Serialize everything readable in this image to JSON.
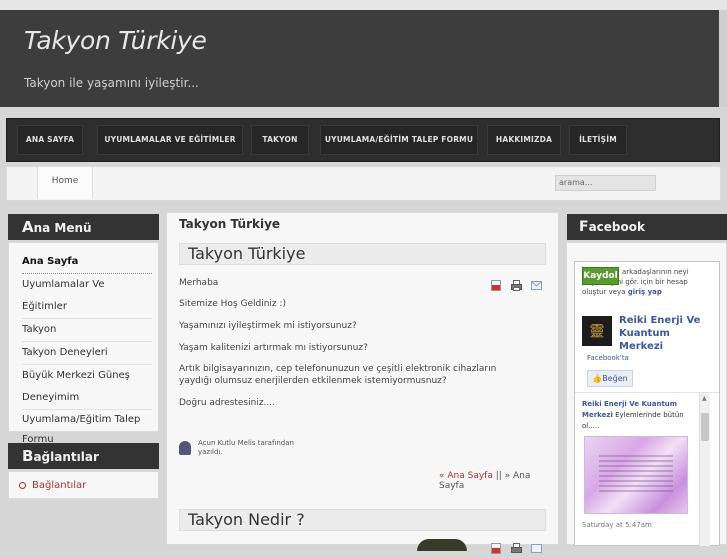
{
  "site": {
    "title": "Takyon Türkiye",
    "slogan": "Takyon ile yaşamını iyileştir..."
  },
  "nav": {
    "items": [
      {
        "label": "ANA SAYFA"
      },
      {
        "label": "UYUMLAMALAR VE EĞİTİMLER"
      },
      {
        "label": "TAKYON"
      },
      {
        "label": "UYUMLAMA/EĞİTİM TALEP FORMU"
      },
      {
        "label": "HAKKIMIZDA"
      },
      {
        "label": "İLETİŞİM"
      }
    ]
  },
  "breadcrumb": {
    "home": "Home"
  },
  "search": {
    "value": "arama..."
  },
  "sidebar": {
    "menu_title_first": "A",
    "menu_title_rest": "na Menü",
    "menu": [
      {
        "label": "Ana Sayfa"
      },
      {
        "label": "Uyumlamalar Ve Eğitimler"
      },
      {
        "label": "Takyon"
      },
      {
        "label": "Takyon Deneyleri"
      },
      {
        "label": "Büyük Merkezi Güneş"
      },
      {
        "label": "Deneyimim"
      },
      {
        "label": "Uyumlama/Eğitim Talep Formu"
      }
    ],
    "links_title_first": "B",
    "links_title_rest": "ağlantılar",
    "links": [
      {
        "label": "Bağlantılar"
      }
    ]
  },
  "main": {
    "page_title": "Takyon Türkiye",
    "article": {
      "title": "Takyon Türkiye",
      "paragraphs": [
        "Merhaba",
        "Sitemize Hoş Geldiniz :)",
        "Yaşamınızı iyileştirmek mi istiyorsunuz?",
        "Yaşam kalitenizi artırmak mı istiyorsunuz?",
        "Artık bilgisayarınızın, cep telefonunuzun ve çeşitli elektronik cihazların yaydığı olumsuz enerjilerden etkilenmek istemiyormusnuz?",
        "Doğru adrestesiniz...."
      ],
      "author": "Acun Kutlu Melis tarafından yazıldı.",
      "pager_prev": "« Ana Sayfa",
      "pager_sep": " || » ",
      "pager_current": "Ana Sayfa"
    },
    "article2": {
      "title": "Takyon Nedir ?"
    }
  },
  "facebook": {
    "title_first": "F",
    "title_rest": "acebook",
    "signup_label": "Kaydol",
    "signup_text": "arkadaşlarının neyi beğendiğini gör. için bir hesap oluştur veya",
    "login_label": "giriş yap",
    "page_logo_glyph": "靈",
    "page_name": "Reiki Enerji Ve Kuantum Merkezi",
    "on_facebook": "Facebook'ta",
    "like_label": "Beğen",
    "post_author": "Reiki Enerji Ve Kuantum Merkezi",
    "post_text": "Eylemlerinde bütün ol.....",
    "post_time": "Saturday at 5:47am"
  },
  "colors": {
    "header_bg": "#3d3d3d",
    "nav_bg": "#2e2e2e",
    "accent_red": "#b03030",
    "facebook_blue": "#3b5998",
    "signup_green": "#5b9a2e"
  }
}
